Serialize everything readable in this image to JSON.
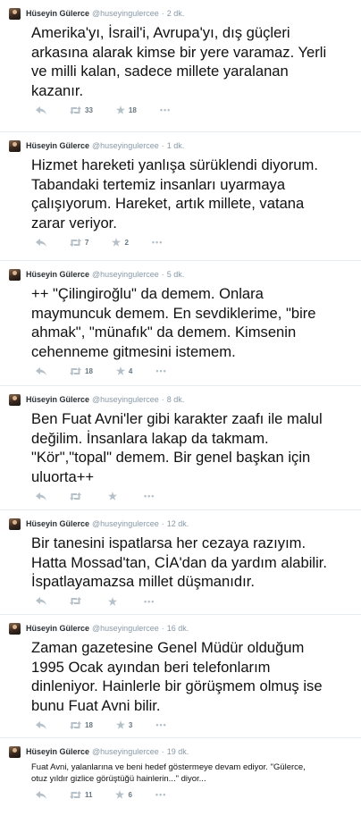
{
  "author": {
    "name": "Hüseyin Gülerce",
    "handle": "@huseyingulercee"
  },
  "separator": "·",
  "more_label": "•••",
  "colors": {
    "meta_gray": "#8899a6",
    "divider": "#e6ecf0",
    "text": "#111111"
  },
  "icons": [
    "reply-icon",
    "retweet-icon",
    "favorite-icon",
    "more-icon"
  ],
  "tweets": [
    {
      "time": "2 dk.",
      "text": "Amerika'yı, İsrail'i, Avrupa'yı, dış güçleri\narkasına alarak kimse bir yere varamaz. Yerli\nve milli kalan, sadece millete yaralanan\nkazanır.",
      "retweets": "33",
      "favorites": "18"
    },
    {
      "time": "1 dk.",
      "text": "Hizmet hareketi yanlışa sürüklendi diyorum.\nTabandaki tertemiz insanları uyarmaya\nçalışıyorum. Hareket, artık millete, vatana\nzarar veriyor.",
      "retweets": "7",
      "favorites": "2"
    },
    {
      "time": "5 dk.",
      "text": "++ \"Çilingiroğlu\" da demem. Onlara\nmaymuncuk demem. En sevdiklerime, \"bire\nahmak\", \"münafık\" da demem. Kimsenin\ncehenneme gitmesini istemem.",
      "retweets": "18",
      "favorites": "4"
    },
    {
      "time": "8 dk.",
      "text": "Ben Fuat Avni'ler gibi karakter zaafı ile malul\ndeğilim. İnsanlara lakap da takmam.\n\"Kör\",\"topal\" demem. Bir genel başkan için\nuluorta++",
      "retweets": "",
      "favorites": ""
    },
    {
      "time": "12 dk.",
      "text": "Bir tanesini ispatlarsa her cezaya razıyım.\nHatta Mossad'tan, CİA'dan da yardım alabilir.\nİspatlayamazsa millet düşmanıdır.",
      "retweets": "",
      "favorites": ""
    },
    {
      "time": "16 dk.",
      "text": "Zaman gazetesine Genel Müdür olduğum\n1995 Ocak ayından beri telefonlarım\ndinleniyor. Hainlerle bir görüşmem olmuş ise\nbunu Fuat Avni bilir.",
      "retweets": "18",
      "favorites": "3"
    },
    {
      "time": "19 dk.",
      "text": "Fuat Avni, yalanlarına ve beni hedef göstermeye devam ediyor. \"Gülerce,\notuz yıldır gizlice görüştüğü hainlerin...\" diyor...",
      "retweets": "11",
      "favorites": "6"
    }
  ]
}
